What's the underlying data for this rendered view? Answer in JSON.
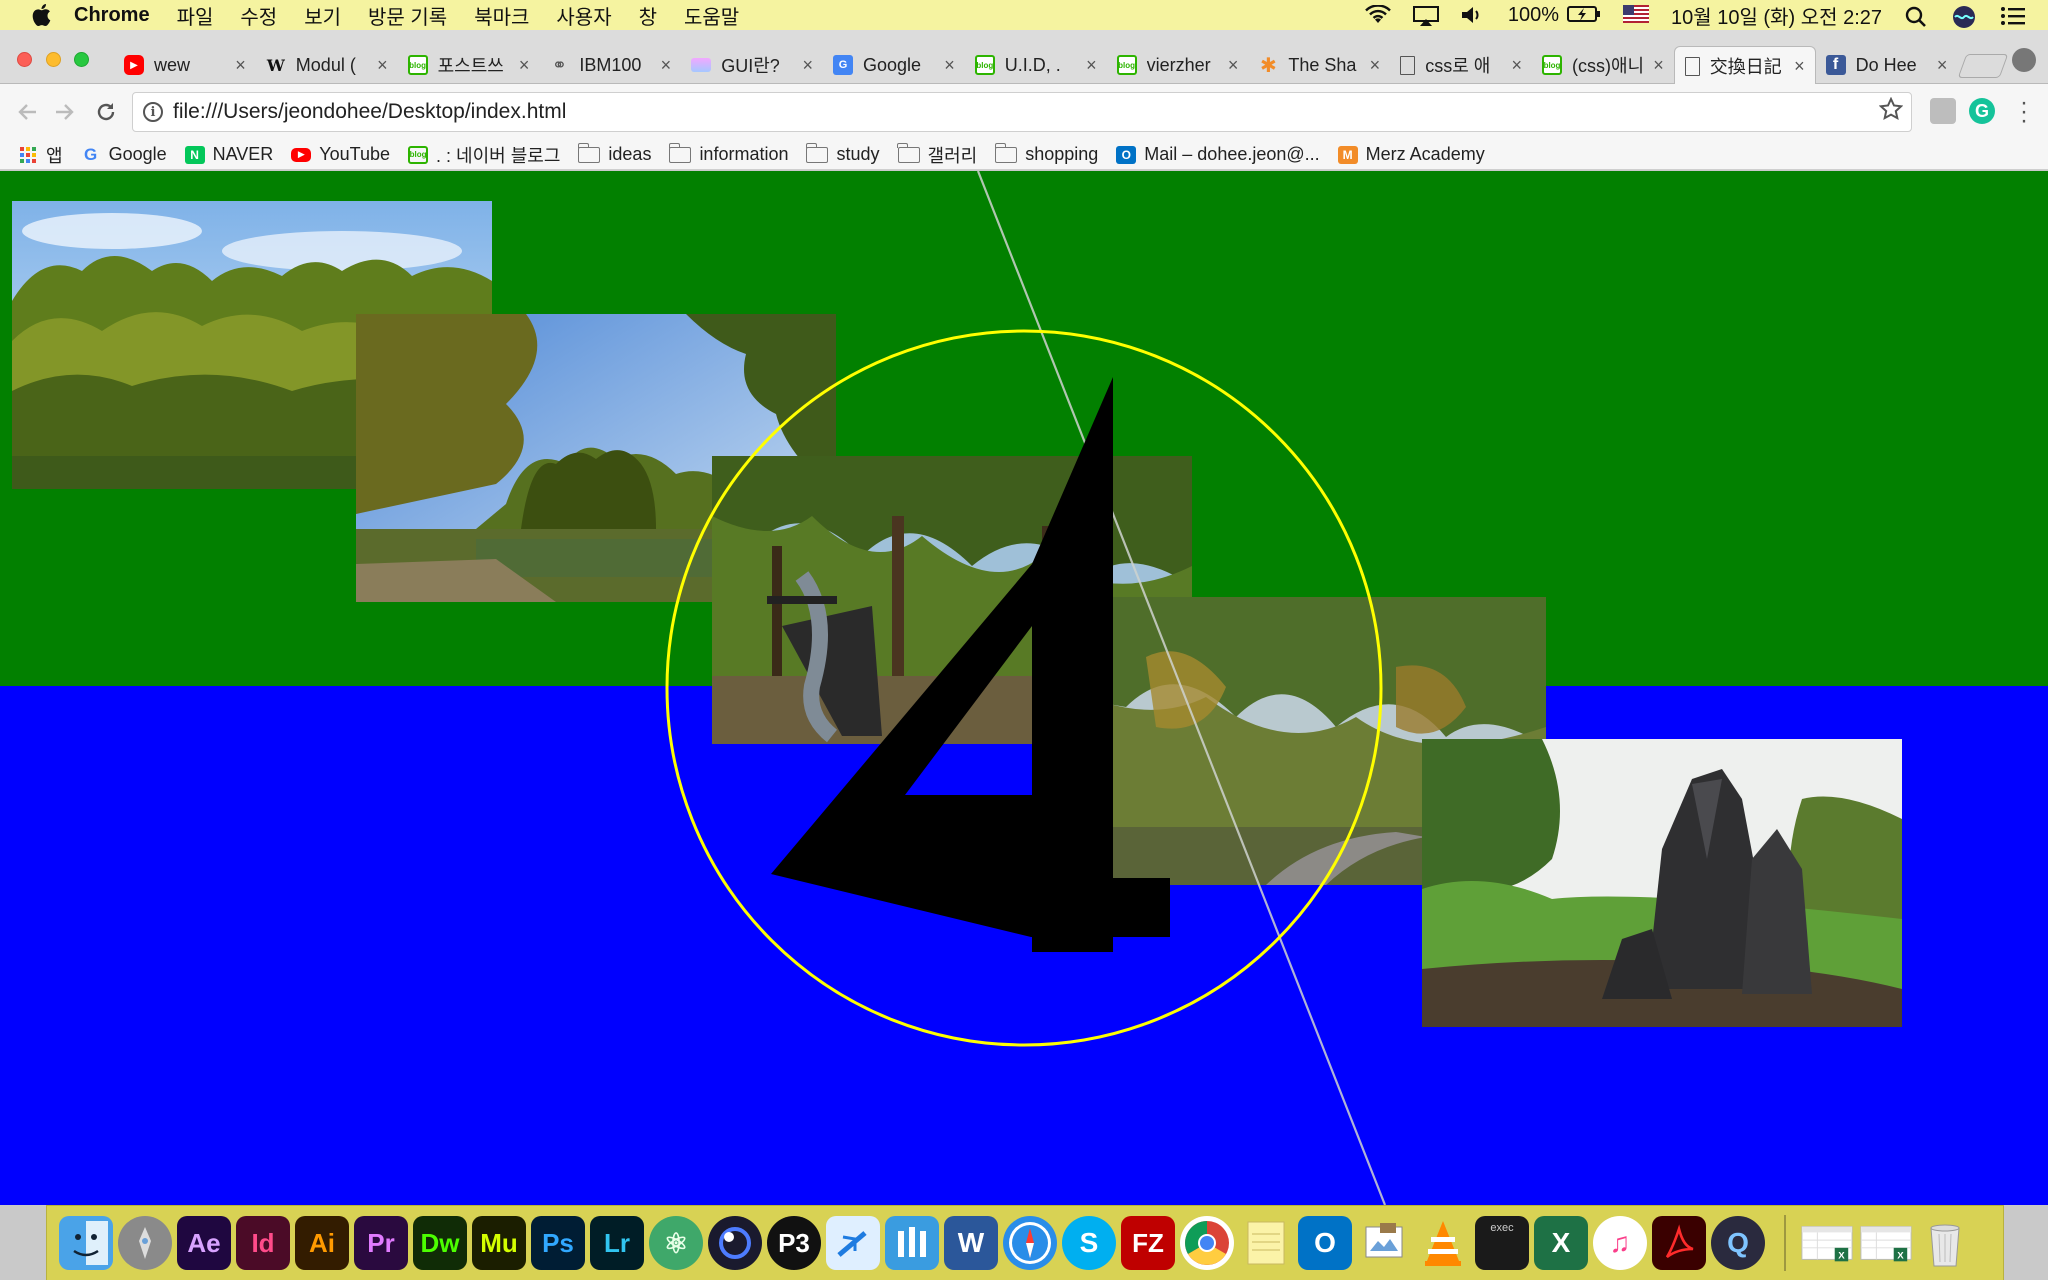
{
  "menubar": {
    "app_name": "Chrome",
    "menus": [
      "파일",
      "수정",
      "보기",
      "방문 기록",
      "북마크",
      "사용자",
      "창",
      "도움말"
    ],
    "battery": "100%",
    "clock": "10월 10일 (화) 오전 2:27"
  },
  "tabs": [
    {
      "title": "wew",
      "favicon": "youtube-icon",
      "color": "#ff0000"
    },
    {
      "title": "Modul (",
      "favicon": "wikipedia-icon",
      "color": "#ffffff"
    },
    {
      "title": "포스트쓰",
      "favicon": "naver-blog-icon",
      "color": "#2db400"
    },
    {
      "title": "IBM100",
      "favicon": "bike-icon",
      "color": "#888888"
    },
    {
      "title": "GUI란? ",
      "favicon": "gradient-icon",
      "color": "#d28cf0"
    },
    {
      "title": "Google ",
      "favicon": "google-docs-icon",
      "color": "#4285f4"
    },
    {
      "title": "U.I.D, . ",
      "favicon": "naver-blog-icon",
      "color": "#2db400"
    },
    {
      "title": "vierzher",
      "favicon": "naver-blog-icon",
      "color": "#2db400"
    },
    {
      "title": "The Sha",
      "favicon": "asterisk-icon",
      "color": "#f28c28"
    },
    {
      "title": "css로 애",
      "favicon": "page-icon",
      "color": "#ffffff"
    },
    {
      "title": "(css)애니",
      "favicon": "naver-blog-icon",
      "color": "#2db400"
    },
    {
      "title": "交換日記",
      "favicon": "page-icon",
      "color": "#ffffff",
      "active": true
    },
    {
      "title": "Do Hee",
      "favicon": "facebook-icon",
      "color": "#3b5998"
    }
  ],
  "address_bar": {
    "url": "file:///Users/jeondohee/Desktop/index.html"
  },
  "bookmarks": [
    {
      "label": "앱",
      "icon": "apps-grid-icon"
    },
    {
      "label": "Google",
      "icon": "google-icon"
    },
    {
      "label": "NAVER",
      "icon": "naver-icon"
    },
    {
      "label": "YouTube",
      "icon": "youtube-icon"
    },
    {
      "label": ". : 네이버 블로그",
      "icon": "naver-blog-icon"
    },
    {
      "label": "ideas",
      "icon": "folder-icon"
    },
    {
      "label": "information",
      "icon": "folder-icon"
    },
    {
      "label": "study",
      "icon": "folder-icon"
    },
    {
      "label": "갤러리",
      "icon": "folder-icon"
    },
    {
      "label": "shopping",
      "icon": "folder-icon"
    },
    {
      "label": "Mail – dohee.jeon@...",
      "icon": "outlook-icon"
    },
    {
      "label": "Merz Academy",
      "icon": "merz-icon"
    }
  ],
  "page": {
    "top_color": "#028000",
    "bottom_color": "#0000ff",
    "circle_color": "#ffff00",
    "big_digit": "4"
  },
  "dock": {
    "apps": [
      {
        "name": "finder-icon",
        "label": "",
        "bg": "#4aa3e8",
        "fg": "#ffffff",
        "round": false
      },
      {
        "name": "launchpad-icon",
        "label": "",
        "bg": "#8a8a8a",
        "fg": "#ffffff",
        "round": true
      },
      {
        "name": "after-effects-icon",
        "label": "Ae",
        "bg": "#1f0740",
        "fg": "#d8a2ff",
        "round": false
      },
      {
        "name": "indesign-icon",
        "label": "Id",
        "bg": "#4b0b27",
        "fg": "#ff4b8a",
        "round": false
      },
      {
        "name": "illustrator-icon",
        "label": "Ai",
        "bg": "#331c00",
        "fg": "#ff9a00",
        "round": false
      },
      {
        "name": "premiere-icon",
        "label": "Pr",
        "bg": "#2a0a3f",
        "fg": "#e17bff",
        "round": false
      },
      {
        "name": "dreamweaver-icon",
        "label": "Dw",
        "bg": "#102c06",
        "fg": "#4cff00",
        "round": false
      },
      {
        "name": "muse-icon",
        "label": "Mu",
        "bg": "#1b1e00",
        "fg": "#d4ff00",
        "round": false
      },
      {
        "name": "photoshop-icon",
        "label": "Ps",
        "bg": "#001d34",
        "fg": "#31a8ff",
        "round": false
      },
      {
        "name": "lightroom-icon",
        "label": "Lr",
        "bg": "#001d26",
        "fg": "#31c5f0",
        "round": false
      },
      {
        "name": "atom-icon",
        "label": "⚛",
        "bg": "#3fa86a",
        "fg": "#e8ffe8",
        "round": true
      },
      {
        "name": "cinema4d-icon",
        "label": "",
        "bg": "#1a1a2e",
        "fg": "#ffffff",
        "round": true
      },
      {
        "name": "processing-icon",
        "label": "P3",
        "bg": "#111111",
        "fg": "#ffffff",
        "round": true
      },
      {
        "name": "paw-icon",
        "label": "",
        "bg": "#dfefff",
        "fg": "#1e7be0",
        "round": false
      },
      {
        "name": "columns-icon",
        "label": "",
        "bg": "#3a9ce0",
        "fg": "#ffffff",
        "round": false
      },
      {
        "name": "word-icon",
        "label": "W",
        "bg": "#2b579a",
        "fg": "#ffffff",
        "round": false
      },
      {
        "name": "safari-icon",
        "label": "",
        "bg": "#2a8de8",
        "fg": "#ffffff",
        "round": true
      },
      {
        "name": "skype-icon",
        "label": "S",
        "bg": "#00aff0",
        "fg": "#ffffff",
        "round": true
      },
      {
        "name": "filezilla-icon",
        "label": "FZ",
        "bg": "#bf0000",
        "fg": "#ffffff",
        "round": false
      },
      {
        "name": "chrome-icon",
        "label": "",
        "bg": "#ffffff",
        "fg": "#db4437",
        "round": true
      },
      {
        "name": "notes-icon",
        "label": "",
        "bg": "#fbf3a8",
        "fg": "#555555",
        "round": false
      },
      {
        "name": "outlook-icon",
        "label": "O",
        "bg": "#0072c6",
        "fg": "#ffffff",
        "round": false
      },
      {
        "name": "preview-icon",
        "label": "",
        "bg": "#a9c6e8",
        "fg": "#555555",
        "round": false
      },
      {
        "name": "vlc-icon",
        "label": "▲",
        "bg": "transparent",
        "fg": "#ff8800",
        "round": false
      },
      {
        "name": "terminal-icon",
        "label": "exec",
        "bg": "#1a1a1a",
        "fg": "#cccccc",
        "round": false
      },
      {
        "name": "excel-icon",
        "label": "X",
        "bg": "#1e7145",
        "fg": "#ffffff",
        "round": false
      },
      {
        "name": "itunes-icon",
        "label": "♫",
        "bg": "#ffffff",
        "fg": "#fa3e8a",
        "round": true
      },
      {
        "name": "acrobat-icon",
        "label": "",
        "bg": "#3a0000",
        "fg": "#ff0000",
        "round": false
      },
      {
        "name": "quicktime-icon",
        "label": "Q",
        "bg": "#2a2a3e",
        "fg": "#7fc4ff",
        "round": true
      }
    ],
    "docs": [
      {
        "name": "excel-document-icon"
      },
      {
        "name": "excel-document-icon"
      },
      {
        "name": "trash-icon"
      }
    ]
  }
}
